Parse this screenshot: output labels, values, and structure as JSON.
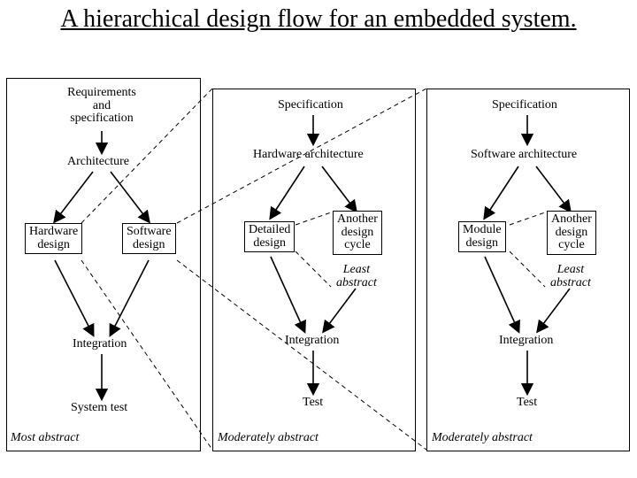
{
  "title": "A hierarchical design flow for an embedded system.",
  "chart_data": {
    "type": "diagram",
    "title": "A hierarchical design flow for an embedded system.",
    "panels": [
      {
        "name": "system",
        "abstract_note": "Most abstract",
        "nodes": [
          {
            "id": "reqspec",
            "label": "Requirements\nand\nspecification",
            "boxed": false
          },
          {
            "id": "arch",
            "label": "Architecture",
            "boxed": false
          },
          {
            "id": "hwdes",
            "label": "Hardware\ndesign",
            "boxed": true
          },
          {
            "id": "swdes",
            "label": "Software\ndesign",
            "boxed": true
          },
          {
            "id": "integ",
            "label": "Integration",
            "boxed": false
          },
          {
            "id": "systest",
            "label": "System test",
            "boxed": false
          }
        ],
        "edges": [
          [
            "reqspec",
            "arch"
          ],
          [
            "arch",
            "hwdes"
          ],
          [
            "arch",
            "swdes"
          ],
          [
            "hwdes",
            "integ"
          ],
          [
            "swdes",
            "integ"
          ],
          [
            "integ",
            "systest"
          ]
        ]
      },
      {
        "name": "hardware",
        "abstract_note": "Moderately abstract",
        "nodes": [
          {
            "id": "spec2",
            "label": "Specification",
            "boxed": false
          },
          {
            "id": "hwarch",
            "label": "Hardware architecture",
            "boxed": false
          },
          {
            "id": "detdes",
            "label": "Detailed\ndesign",
            "boxed": true
          },
          {
            "id": "another1",
            "label": "Another\ndesign\ncycle",
            "boxed": true
          },
          {
            "id": "least1",
            "label": "Least\nabstract",
            "boxed": false,
            "italic": true
          },
          {
            "id": "integ2",
            "label": "Integration",
            "boxed": false
          },
          {
            "id": "test2",
            "label": "Test",
            "boxed": false
          }
        ],
        "edges": [
          [
            "spec2",
            "hwarch"
          ],
          [
            "hwarch",
            "detdes"
          ],
          [
            "hwarch",
            "another1"
          ],
          [
            "detdes",
            "integ2"
          ],
          [
            "another1",
            "integ2"
          ],
          [
            "integ2",
            "test2"
          ]
        ]
      },
      {
        "name": "software",
        "abstract_note": "Moderately abstract",
        "nodes": [
          {
            "id": "spec3",
            "label": "Specification",
            "boxed": false
          },
          {
            "id": "swarch",
            "label": "Software architecture",
            "boxed": false
          },
          {
            "id": "moddes",
            "label": "Module\ndesign",
            "boxed": true
          },
          {
            "id": "another2",
            "label": "Another\ndesign\ncycle",
            "boxed": true
          },
          {
            "id": "least2",
            "label": "Least\nabstract",
            "boxed": false,
            "italic": true
          },
          {
            "id": "integ3",
            "label": "Integration",
            "boxed": false
          },
          {
            "id": "test3",
            "label": "Test",
            "boxed": false
          }
        ],
        "edges": [
          [
            "spec3",
            "swarch"
          ],
          [
            "swarch",
            "moddes"
          ],
          [
            "swarch",
            "another2"
          ],
          [
            "moddes",
            "integ3"
          ],
          [
            "another2",
            "integ3"
          ],
          [
            "integ3",
            "test3"
          ]
        ]
      }
    ],
    "cross_links": [
      {
        "from_panel": "system",
        "from_node": "hwdes",
        "to_panel": "hardware",
        "style": "dashed"
      },
      {
        "from_panel": "system",
        "from_node": "swdes",
        "to_panel": "software",
        "style": "dashed"
      },
      {
        "from_panel": "hardware",
        "from_node": "detdes",
        "to_panel": "(next)",
        "style": "dashed"
      },
      {
        "from_panel": "software",
        "from_node": "moddes",
        "to_panel": "(next)",
        "style": "dashed"
      }
    ]
  }
}
